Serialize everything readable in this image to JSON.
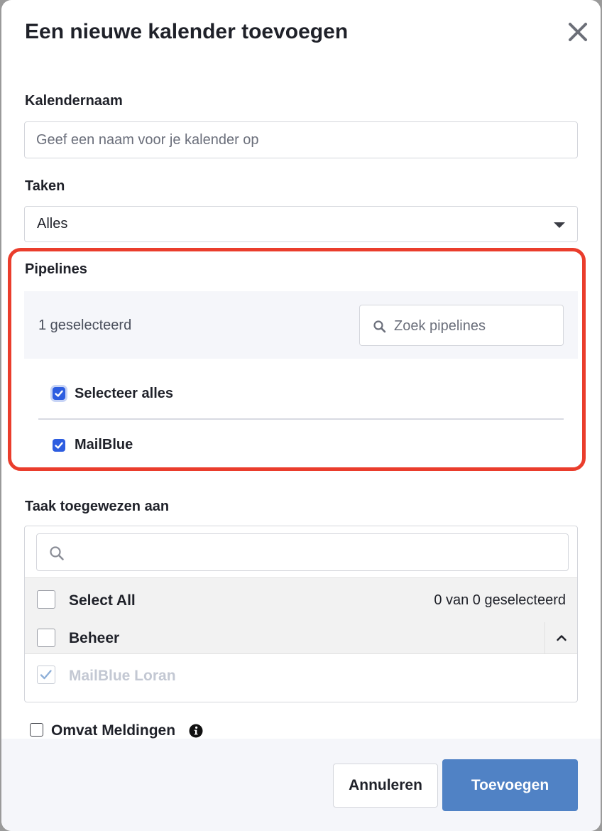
{
  "dialog": {
    "title": "Een nieuwe kalender toevoegen"
  },
  "calendar_name": {
    "label": "Kalendernaam",
    "placeholder": "Geef een naam voor je kalender op",
    "value": ""
  },
  "tasks": {
    "label": "Taken",
    "selected": "Alles"
  },
  "pipelines": {
    "label": "Pipelines",
    "selected_count": "1 geselecteerd",
    "search_placeholder": "Zoek pipelines",
    "select_all_label": "Selecteer alles",
    "select_all_checked": true,
    "items": [
      {
        "label": "MailBlue",
        "checked": true
      }
    ]
  },
  "assigned_to": {
    "label": "Taak toegewezen aan",
    "search_value": "",
    "select_all_label": "Select All",
    "count_text": "0 van 0 geselecteerd",
    "group_label": "Beheer",
    "users": [
      {
        "label": "MailBlue Loran",
        "checked": true,
        "disabled": true
      }
    ]
  },
  "notifications": {
    "label": "Omvat Meldingen",
    "checked": false
  },
  "footer": {
    "cancel_label": "Annuleren",
    "submit_label": "Toevoegen"
  },
  "colors": {
    "highlight": "#ea3d2c",
    "primary_button": "#5082c5",
    "checkbox_blue": "#2d5de0"
  }
}
